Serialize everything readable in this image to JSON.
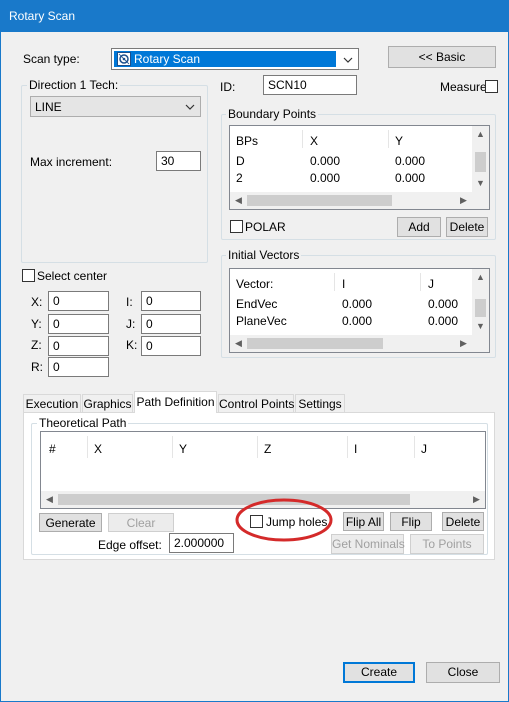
{
  "window": {
    "title": "Rotary Scan"
  },
  "scan_type": {
    "label": "Scan type:",
    "value": "Rotary Scan",
    "basic_button": "<< Basic"
  },
  "direction1": {
    "group_title": "Direction 1 Tech:",
    "combo_value": "LINE",
    "max_increment_label": "Max increment:",
    "max_increment_value": "30"
  },
  "id": {
    "label": "ID:",
    "value": "SCN10"
  },
  "measure": {
    "label": "Measure"
  },
  "boundary_points": {
    "group_title": "Boundary Points",
    "headers": [
      "BPs",
      "X",
      "Y"
    ],
    "rows": [
      [
        "D",
        "0.000",
        "0.000"
      ],
      [
        "2",
        "0.000",
        "0.000"
      ]
    ],
    "polar_label": "POLAR",
    "add_button": "Add",
    "delete_button": "Delete"
  },
  "initial_vectors": {
    "group_title": "Initial Vectors",
    "headers": [
      "Vector:",
      "I",
      "J"
    ],
    "rows": [
      [
        "EndVec",
        "0.000",
        "0.000"
      ],
      [
        "PlaneVec",
        "0.000",
        "0.000"
      ]
    ]
  },
  "select_center": {
    "label": "Select center",
    "fields": {
      "x_label": "X:",
      "x_value": "0",
      "y_label": "Y:",
      "y_value": "0",
      "z_label": "Z:",
      "z_value": "0",
      "r_label": "R:",
      "r_value": "0",
      "i_label": "I:",
      "i_value": "0",
      "j_label": "J:",
      "j_value": "0",
      "k_label": "K:",
      "k_value": "0"
    }
  },
  "tabs": {
    "items": [
      "Execution",
      "Graphics",
      "Path Definition",
      "Control Points",
      "Settings"
    ],
    "active": "Path Definition"
  },
  "theoretical_path": {
    "group_title": "Theoretical Path",
    "headers": [
      "#",
      "X",
      "Y",
      "Z",
      "I",
      "J"
    ],
    "generate_button": "Generate",
    "clear_button": "Clear",
    "jump_holes_label": "Jump holes",
    "flip_all_button": "Flip All",
    "flip_button": "Flip",
    "delete_button": "Delete",
    "edge_offset_label": "Edge offset:",
    "edge_offset_value": "2.000000",
    "get_nominals_button": "Get Nominals",
    "to_points_button": "To Points"
  },
  "footer": {
    "create_button": "Create",
    "close_button": "Close"
  },
  "colors": {
    "titlebar": "#1979ca",
    "highlight": "#0078d7",
    "annotation": "#d42a2a"
  }
}
